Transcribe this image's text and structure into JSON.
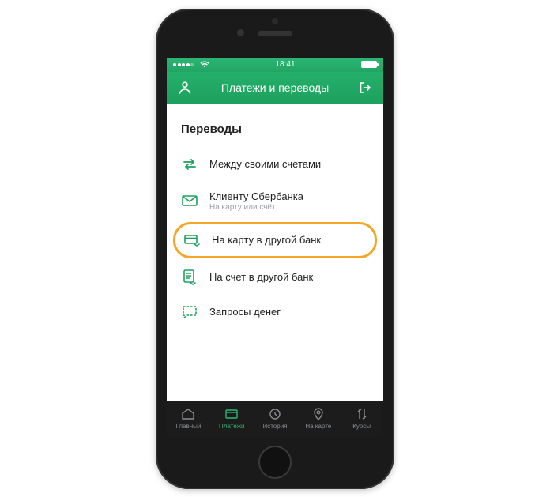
{
  "status": {
    "carrier": "",
    "time": "18:41"
  },
  "header": {
    "title": "Платежи и переводы"
  },
  "section": {
    "title": "Переводы"
  },
  "items": [
    {
      "label": "Между своими счетами",
      "sub": "",
      "highlighted": false
    },
    {
      "label": "Клиенту Сбербанка",
      "sub": "На карту или счёт",
      "highlighted": false
    },
    {
      "label": "На карту в другой банк",
      "sub": "",
      "highlighted": true
    },
    {
      "label": "На счет в другой банк",
      "sub": "",
      "highlighted": false
    },
    {
      "label": "Запросы денег",
      "sub": "",
      "highlighted": false
    }
  ],
  "tabs": [
    {
      "label": "Главный",
      "active": false
    },
    {
      "label": "Платежи",
      "active": true
    },
    {
      "label": "История",
      "active": false
    },
    {
      "label": "На карте",
      "active": false
    },
    {
      "label": "Курсы",
      "active": false
    }
  ]
}
